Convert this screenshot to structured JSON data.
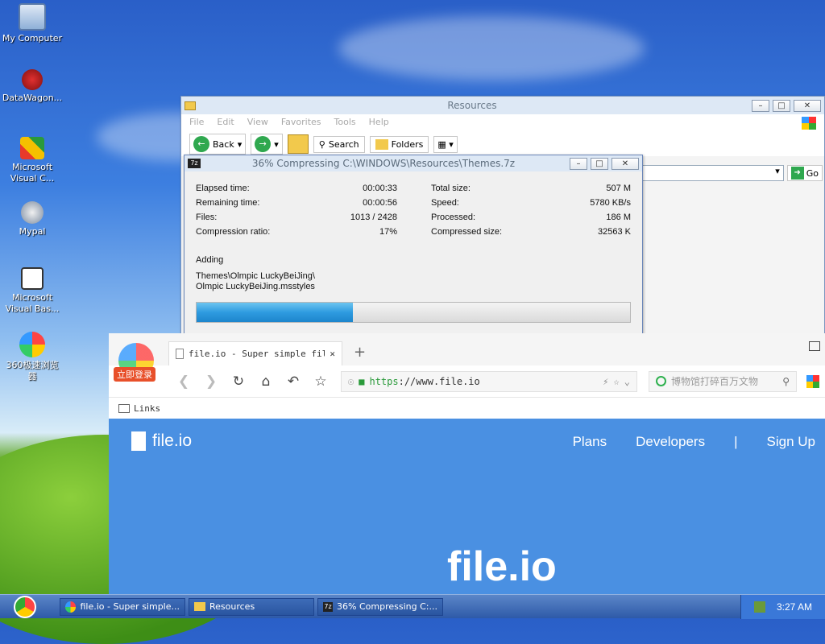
{
  "desktop": {
    "icons": [
      {
        "label": "My Computer",
        "icon": "computer-icon"
      },
      {
        "label": "DataWagon...",
        "icon": "datawagon-icon"
      },
      {
        "label": "Microsoft Visual C...",
        "icon": "visual-c-icon"
      },
      {
        "label": "Mypal",
        "icon": "mypal-icon"
      },
      {
        "label": "Microsoft Visual Bas...",
        "icon": "visual-basic-icon"
      },
      {
        "label": "360极速浏览器",
        "icon": "browser-360-icon"
      }
    ]
  },
  "explorer": {
    "title": "Resources",
    "menu": [
      "File",
      "Edit",
      "View",
      "Favorites",
      "Tools",
      "Help"
    ],
    "toolbar": {
      "back": "Back",
      "search": "Search",
      "folders": "Folders"
    },
    "go_label": "Go"
  },
  "zip_dialog": {
    "title": "36% Compressing C:\\WINDOWS\\Resources\\Themes.7z",
    "left": [
      {
        "label": "Elapsed time:",
        "value": "00:00:33"
      },
      {
        "label": "Remaining time:",
        "value": "00:00:56"
      },
      {
        "label": "Files:",
        "value": "1013 / 2428"
      },
      {
        "label": "Compression ratio:",
        "value": "17%"
      }
    ],
    "right": [
      {
        "label": "Total size:",
        "value": "507 M"
      },
      {
        "label": "Speed:",
        "value": "5780 KB/s"
      },
      {
        "label": "Processed:",
        "value": "186 M"
      },
      {
        "label": "Compressed size:",
        "value": "32563 K"
      }
    ],
    "action": "Adding",
    "path_line1": "Themes\\Olmpic LuckyBeiJing\\",
    "path_line2": "Olmpic LuckyBeiJing.msstyles",
    "progress": 0.36
  },
  "browser": {
    "login_badge": "立即登录",
    "tab_title": "file.io - Super simple fil",
    "url_scheme": "https",
    "url_rest": "://www.file.io",
    "search_placeholder": "博物馆打碎百万文物",
    "bookmark": "Links",
    "site": {
      "logo": "file.io",
      "nav": [
        "Plans",
        "Developers",
        "|",
        "Sign Up"
      ],
      "hero": "file.io"
    }
  },
  "taskbar": {
    "tasks": [
      "file.io - Super simple...",
      "Resources",
      "36% Compressing C:..."
    ],
    "clock": "3:27 AM"
  },
  "colors": {
    "site_blue": "#4a90e2",
    "progress_blue": "#2e9be0",
    "taskbar_blue": "#2e5aa8"
  }
}
